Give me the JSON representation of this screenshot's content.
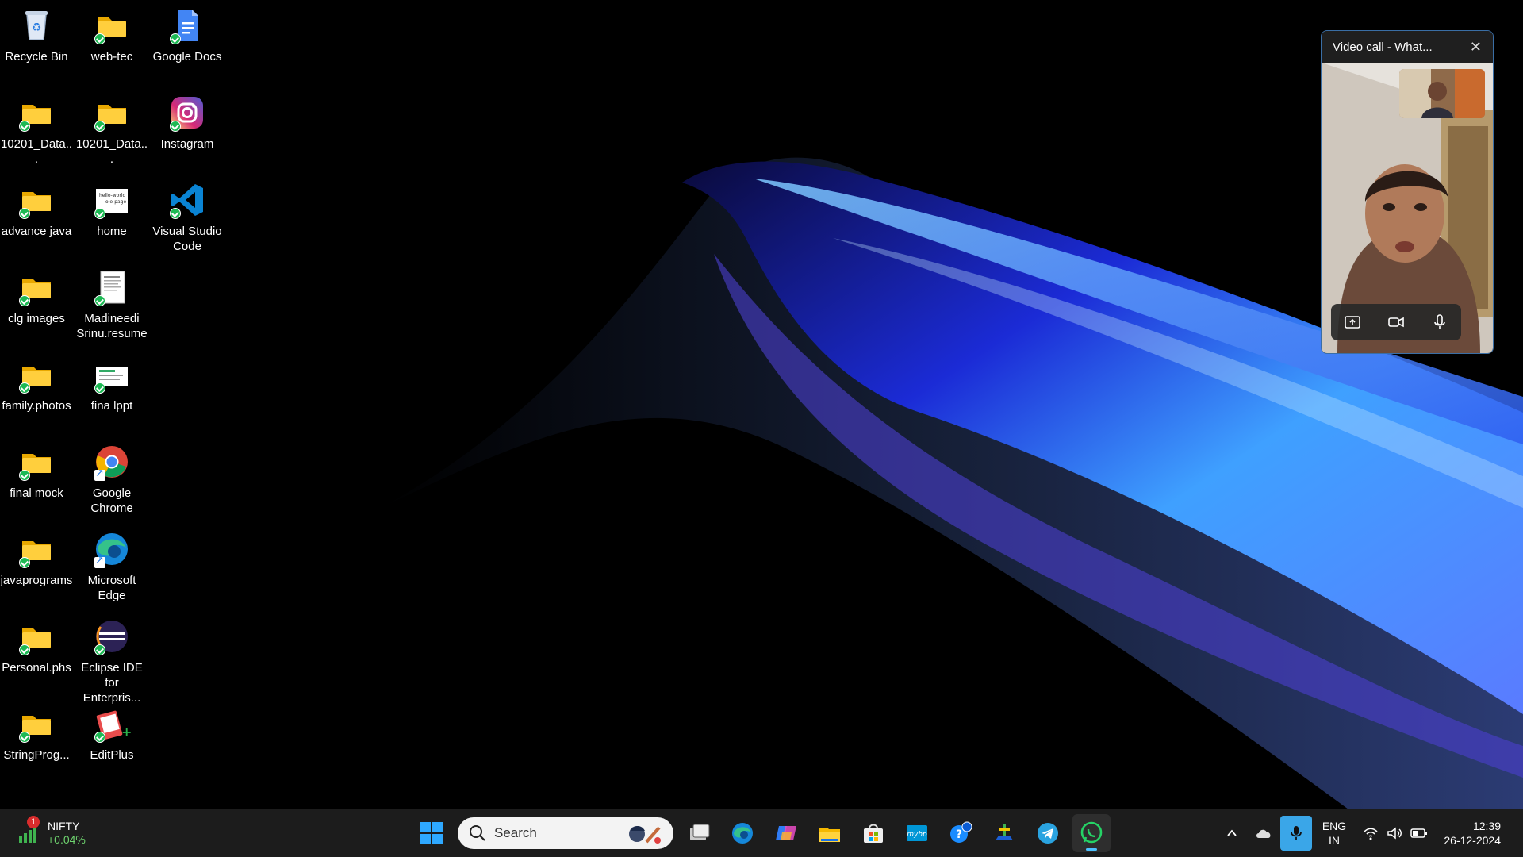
{
  "desktop": {
    "icons": [
      {
        "label": "Recycle Bin",
        "icon": "recycle-bin-icon"
      },
      {
        "label": "web-tec",
        "icon": "folder-icon"
      },
      {
        "label": "Google Docs",
        "icon": "google-docs-icon"
      },
      {
        "label": "10201_Data...",
        "icon": "folder-icon"
      },
      {
        "label": "10201_Data...",
        "icon": "folder-icon"
      },
      {
        "label": "Instagram",
        "icon": "instagram-icon"
      },
      {
        "label": "advance java",
        "icon": "folder-icon"
      },
      {
        "label": "home",
        "icon": "html-file-icon"
      },
      {
        "label": "Visual Studio Code",
        "icon": "vscode-icon"
      },
      {
        "label": "clg images",
        "icon": "folder-icon"
      },
      {
        "label": "Madineedi Srinu.resume",
        "icon": "document-icon"
      },
      {
        "label": "family.photos",
        "icon": "folder-icon"
      },
      {
        "label": "fina lppt",
        "icon": "presentation-icon"
      },
      {
        "label": "final mock",
        "icon": "folder-icon"
      },
      {
        "label": "Google Chrome",
        "icon": "chrome-icon"
      },
      {
        "label": "javaprograms",
        "icon": "folder-icon"
      },
      {
        "label": "Microsoft Edge",
        "icon": "edge-icon"
      },
      {
        "label": "Personal.phs",
        "icon": "folder-icon"
      },
      {
        "label": "Eclipse IDE for Enterpris...",
        "icon": "eclipse-icon"
      },
      {
        "label": "StringProg...",
        "icon": "folder-icon"
      },
      {
        "label": "EditPlus",
        "icon": "editplus-icon"
      }
    ],
    "home_thumb_text": [
      "hello-world",
      "ole-page"
    ]
  },
  "video_call": {
    "title": "Video call - What...",
    "controls": [
      "share-screen-icon",
      "camera-icon",
      "microphone-icon"
    ]
  },
  "taskbar": {
    "widget": {
      "badge": "1",
      "name": "NIFTY",
      "change": "+0.04%"
    },
    "search_placeholder": "Search",
    "apps": [
      "start-icon",
      "task-view-icon",
      "edge-icon",
      "copilot-icon",
      "file-explorer-icon",
      "microsoft-store-icon",
      "myhp-icon",
      "get-help-icon",
      "app-icon",
      "telegram-icon",
      "whatsapp-icon"
    ],
    "tray": {
      "lang_top": "ENG",
      "lang_bottom": "IN",
      "time": "12:39",
      "date": "26-12-2024"
    }
  },
  "colors": {
    "taskbar_bg": "#1c1c1c",
    "accent": "#4cc2ff",
    "folder": "#f7c948",
    "sync_green": "#1db954"
  }
}
